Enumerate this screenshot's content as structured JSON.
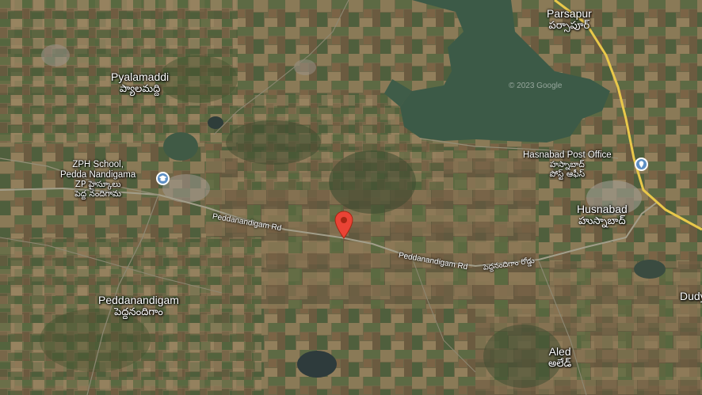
{
  "colors": {
    "accent_pin": "#ea4335",
    "poi_badge": "#5e8fc4",
    "road_yellow": "#e9c84a",
    "water": "#3c5a47"
  },
  "places": {
    "parsapur": {
      "en": "Parsapur",
      "te": "పర్సాపూర్"
    },
    "pyalamaddi": {
      "en": "Pyalamaddi",
      "te": "ప్యాలమద్ది"
    },
    "zph_school": {
      "en1": "ZPH School,",
      "en2": "Pedda Nandigama",
      "te1": "ZP హైస్కూలు",
      "te2": "పెద్ద నందిగామ",
      "icon": "school-icon"
    },
    "hasnabad_po": {
      "en": "Hasnabad Post Office",
      "te1": "హస్నాబాద్",
      "te2": "పోస్ట్ ఆఫీస్",
      "icon": "post-office-icon"
    },
    "husnabad": {
      "en": "Husnabad",
      "te": "హుస్నాబాద్"
    },
    "peddanandigam": {
      "en": "Peddanandigam",
      "te": "పెద్దనందిగాం"
    },
    "aled": {
      "en": "Aled",
      "te": "అలేడ్"
    },
    "dudy": {
      "en": "Dudy"
    }
  },
  "roads": {
    "road_a": "Peddanandigam Rd",
    "road_b": "Peddanandigam Rd",
    "road_te": "పెద్దనందిగాం రోడ్డు"
  },
  "watermark": "© 2023 Google",
  "pin": {
    "icon": "location-pin-icon"
  }
}
